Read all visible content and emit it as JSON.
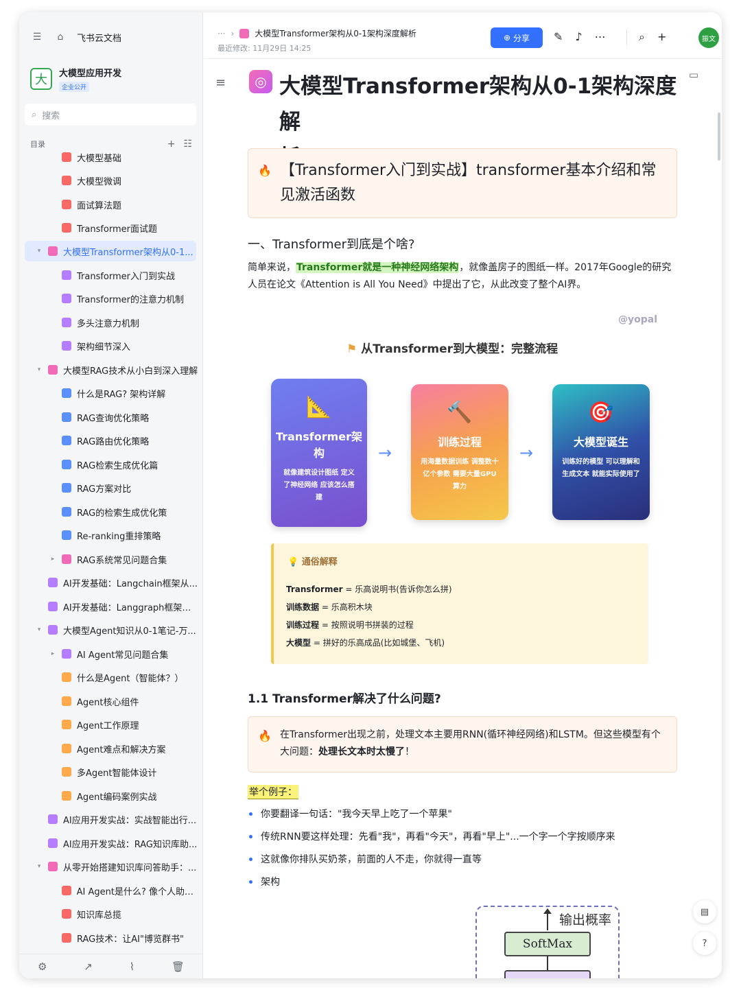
{
  "sidebar": {
    "home_label": "飞书云文档",
    "space_logo_char": "大",
    "space_name": "大模型应用开发",
    "space_badge": "企业公开",
    "search_placeholder": "搜索",
    "toc_label": "目录",
    "items": [
      {
        "label": "大模型基础",
        "color": "red"
      },
      {
        "label": "大模型微调",
        "color": "red"
      },
      {
        "label": "面试算法题",
        "color": "red"
      },
      {
        "label": "Transformer面试题",
        "color": "red"
      },
      {
        "label": "大模型Transformer架构从0-1...",
        "color": "pink"
      },
      {
        "label": "Transformer入门到实战",
        "color": "purple"
      },
      {
        "label": "Transformer的注意力机制",
        "color": "purple"
      },
      {
        "label": "多头注意力机制",
        "color": "purple"
      },
      {
        "label": "架构细节深入",
        "color": "purple"
      },
      {
        "label": "大模型RAG技术从小白到深入理解",
        "color": "pink"
      },
      {
        "label": "什么是RAG? 架构详解",
        "color": "blue"
      },
      {
        "label": "RAG查询优化策略",
        "color": "blue"
      },
      {
        "label": "RAG路由优化策略",
        "color": "blue"
      },
      {
        "label": "RAG检索生成优化篇",
        "color": "blue"
      },
      {
        "label": "RAG方案对比",
        "color": "blue"
      },
      {
        "label": "RAG的检索生成优化策",
        "color": "blue"
      },
      {
        "label": "Re-ranking重排策略",
        "color": "blue"
      },
      {
        "label": "RAG系统常见问题合集",
        "color": "pink"
      },
      {
        "label": "AI开发基础：Langchain框架从...",
        "color": "purple"
      },
      {
        "label": "AI开发基础：Langgraph框架从...",
        "color": "purple"
      },
      {
        "label": "大模型Agent知识从0-1笔记-万...",
        "color": "purple"
      },
      {
        "label": "AI Agent常见问题合集",
        "color": "purple"
      },
      {
        "label": "什么是Agent（智能体？）",
        "color": "orange"
      },
      {
        "label": "Agent核心组件",
        "color": "orange"
      },
      {
        "label": "Agent工作原理",
        "color": "orange"
      },
      {
        "label": "Agent难点和解决方案",
        "color": "orange"
      },
      {
        "label": "多Agent智能体设计",
        "color": "orange"
      },
      {
        "label": "Agent编码案例实战",
        "color": "orange"
      },
      {
        "label": "AI应用开发实战：实战智能出行...",
        "color": "purple"
      },
      {
        "label": "AI应用开发实战：RAG知识库助...",
        "color": "purple"
      },
      {
        "label": "从零开始搭建知识库问答助手：...",
        "color": "pink"
      },
      {
        "label": "AI Agent是什么? 像个人助理...",
        "color": "red"
      },
      {
        "label": "知识库总揽",
        "color": "red"
      },
      {
        "label": "RAG技术：让AI\"博览群书\"",
        "color": "red"
      }
    ]
  },
  "header": {
    "breadcrumb_more": "···",
    "breadcrumb_title": "大模型Transformer架构从0-1架构深度解析",
    "modified": "最近修改: 11月29日 14:25",
    "share_label": "分享",
    "avatar_text": "振文"
  },
  "doc": {
    "title_line1": "大模型Transformer架构从0-1架构深度解",
    "title_line2": "析",
    "callout1": "【Transformer入门到实战】transformer基本介绍和常见激活函数",
    "h2": "一、Transformer到底是个啥?",
    "para_pre": "简单来说，",
    "para_highlight": "Transformer就是一种神经网络架构",
    "para_post": "，就像盖房子的图纸一样。2017年Google的研究人员在论文《Attention is All You Need》中提出了它，从此改变了整个AI界。",
    "watermark": "@yopal",
    "flow_title": "从Transformer到大模型：完整流程",
    "cards": [
      {
        "title": "Transformer架构",
        "desc": "就像建筑设计图纸 定义了神经网络 应该怎么搭建",
        "icon": "📐"
      },
      {
        "title": "训练过程",
        "desc": "用海量数据训练 调整数十亿个参数 需要大量GPU算力",
        "icon": "🔨"
      },
      {
        "title": "大模型诞生",
        "desc": "训练好的模型 可以理解和生成文本 就能实际使用了",
        "icon": "🎯"
      }
    ],
    "explain_title": "通俗解释",
    "explain_rows": [
      {
        "key": "Transformer",
        "val": " = 乐高说明书(告诉你怎么拼)"
      },
      {
        "key": "训练数据",
        "val": " = 乐高积木块"
      },
      {
        "key": "训练过程",
        "val": " = 按照说明书拼装的过程"
      },
      {
        "key": "大模型",
        "val": " = 拼好的乐高成品(比如城堡、飞机)"
      }
    ],
    "h3": "1.1 Transformer解决了什么问题?",
    "callout2_pre": "在Transformer出现之前，处理文本主要用RNN(循环神经网络)和LSTM。但这些模型有个大问题：",
    "callout2_bold": "处理长文本时太慢了",
    "callout2_post": "！",
    "example_label": "举个例子：",
    "bullets": [
      "你要翻译一句话：\"我今天早上吃了一个苹果\"",
      "传统RNN要这样处理：先看\"我\"，再看\"今天\"，再看\"早上\"...一个字一个字按顺序来",
      "这就像你排队买奶茶，前面的人不走，你就得一直等",
      "架构"
    ],
    "arch_output": "输出概率",
    "arch_softmax": "SoftMax"
  }
}
